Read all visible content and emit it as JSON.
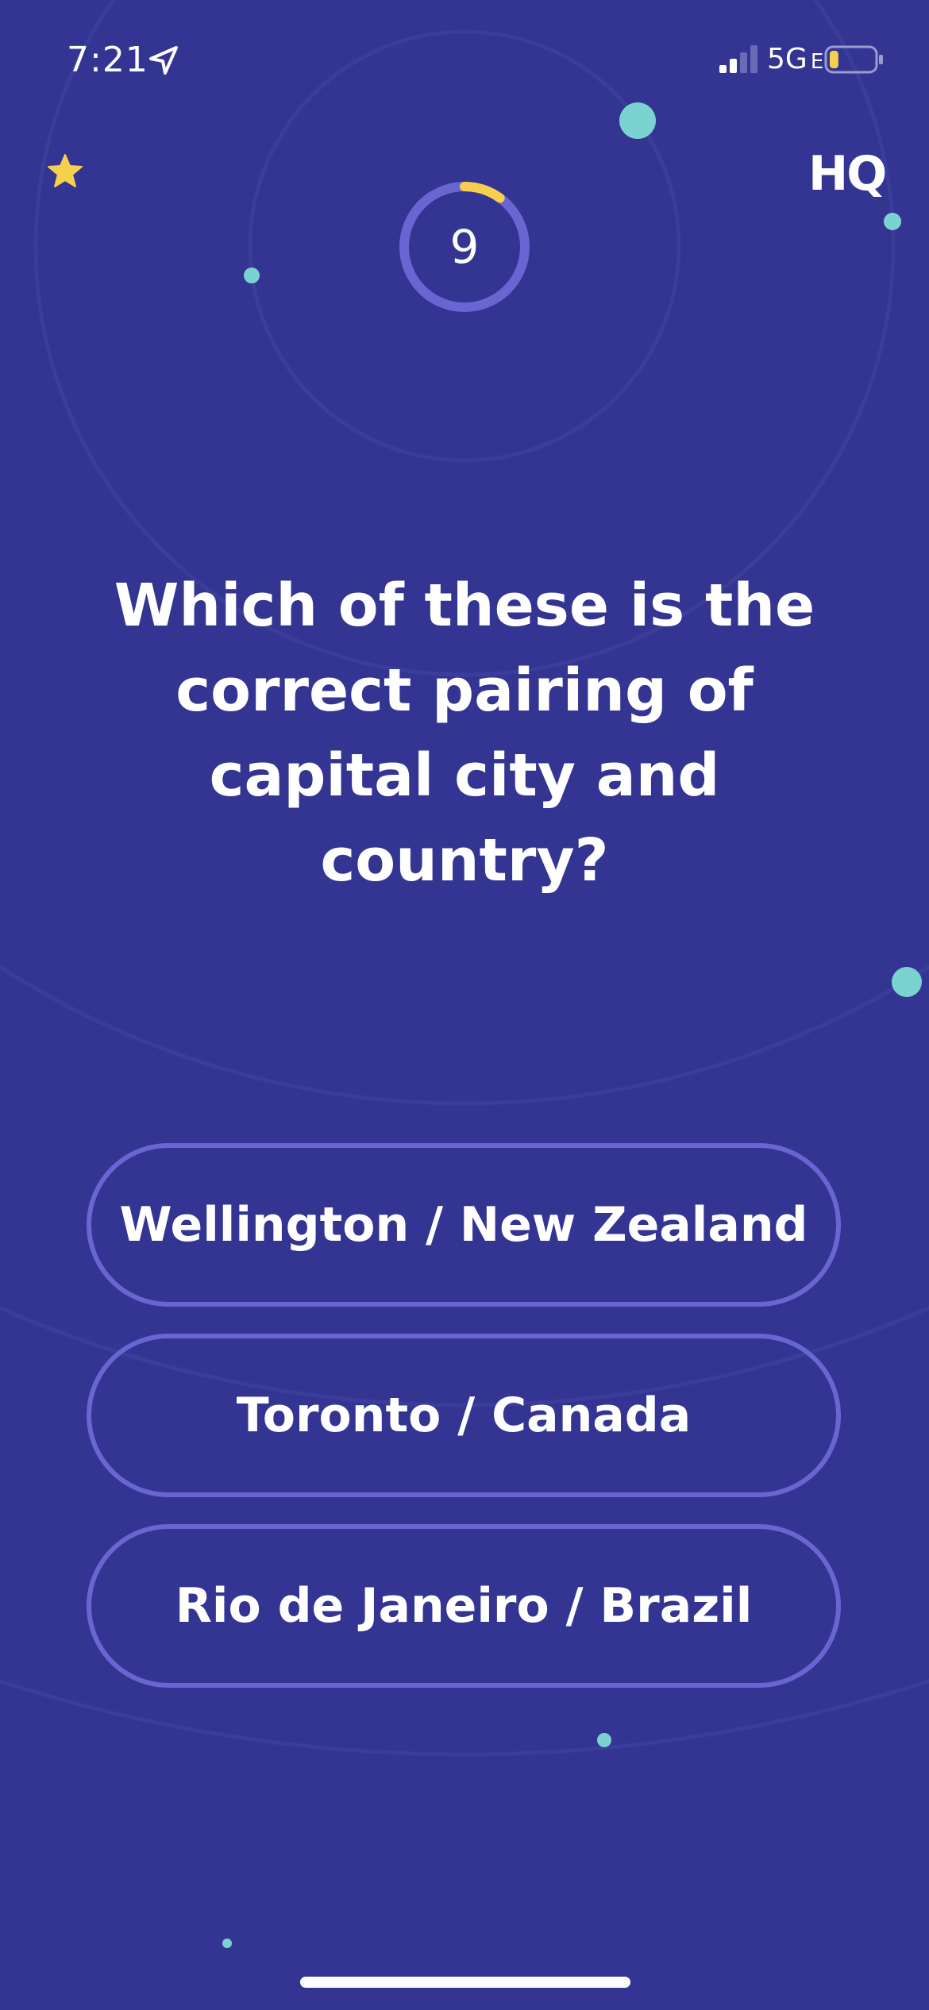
{
  "status_bar": {
    "time": "7:21",
    "network": "5G",
    "network_suffix": "E",
    "battery_level": 0.2
  },
  "header": {
    "logo": "HQ",
    "timer_value": "9",
    "timer_progress": 0.1
  },
  "question": {
    "text": "Which of these is the correct pairing of capital city and country?"
  },
  "answers": [
    {
      "label": "Wellington / New Zealand"
    },
    {
      "label": "Toronto / Canada"
    },
    {
      "label": "Rio de Janeiro / Brazil"
    }
  ],
  "colors": {
    "background": "#343592",
    "answer_border": "#6966d4",
    "timer_ring": "#6966d4",
    "timer_progress": "#f6d04d",
    "star": "#f6d04d",
    "accent_dot": "#7ad3d0"
  },
  "icons": {
    "location": "location-arrow-icon",
    "signal": "cellular-signal-icon",
    "battery": "battery-icon",
    "star": "star-icon"
  }
}
